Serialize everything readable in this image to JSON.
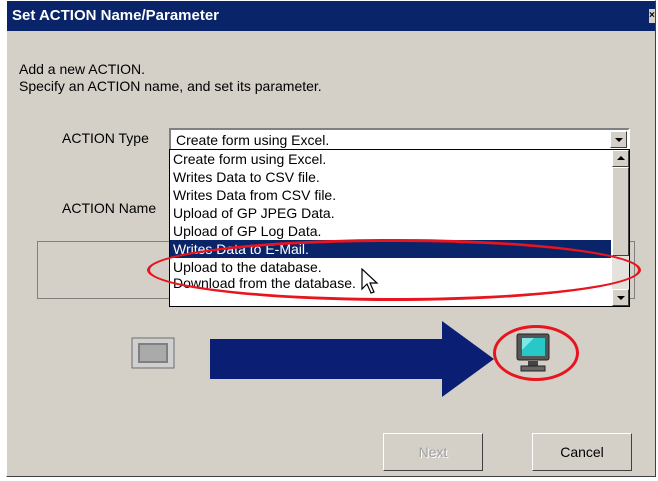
{
  "dialog": {
    "title": "Set ACTION Name/Parameter",
    "close_glyph": "×",
    "intro_line1": "Add a new ACTION.",
    "intro_line2": "Specify an ACTION name, and set its parameter."
  },
  "form": {
    "action_type_label": "ACTION Type",
    "action_name_label": "ACTION Name",
    "action_type_value": "Create form using Excel."
  },
  "dropdown": {
    "items": [
      "Create form using Excel.",
      "Writes Data to CSV file.",
      "Writes Data from CSV file.",
      "Upload of GP JPEG Data.",
      "Upload of GP Log Data.",
      "Writes Data to E-Mail.",
      "Upload to the database.",
      "Download from the database."
    ],
    "selected_index": 5
  },
  "buttons": {
    "next": "Next",
    "cancel": "Cancel"
  },
  "colors": {
    "titlebar": "#0a246a",
    "selection": "#0a246a",
    "flow_arrow": "#0a1e73",
    "highlight": "#e8141e"
  },
  "icons": [
    "gp-device-icon",
    "flow-arrow-icon",
    "pc-monitor-icon",
    "mouse-cursor-icon"
  ]
}
